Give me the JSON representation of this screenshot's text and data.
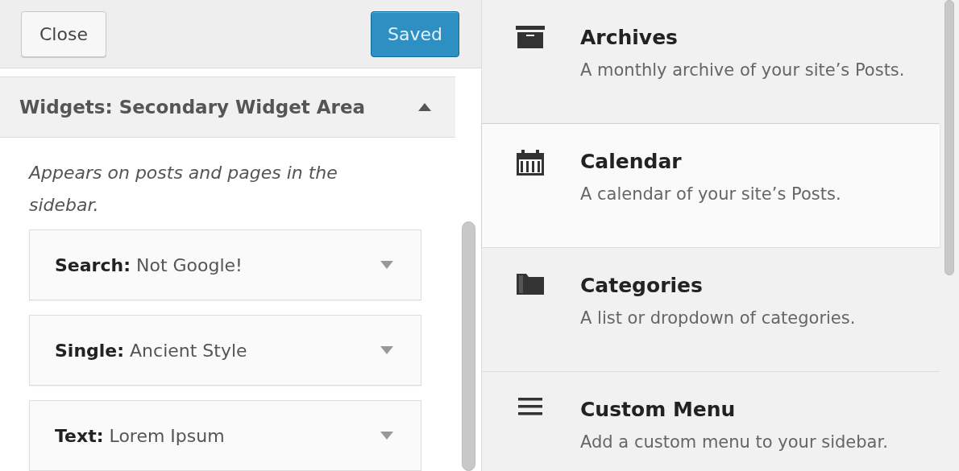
{
  "header": {
    "buttons": [
      {
        "label": "Close",
        "kind": "secondary"
      },
      {
        "label": "Saved",
        "kind": "primary"
      }
    ]
  },
  "section": {
    "title": "Widgets: Secondary Widget Area",
    "expanded": true,
    "description": "Appears on posts and pages in the sidebar.",
    "widgets": [
      {
        "type": "Search:",
        "title": "Not Google!"
      },
      {
        "type": "Single:",
        "title": "Ancient Style"
      },
      {
        "type": "Text:",
        "title": "Lorem Ipsum"
      }
    ]
  },
  "available_widgets": [
    {
      "name": "Archives",
      "description": "A monthly archive of your site’s Posts.",
      "kind": "archive",
      "selected": false
    },
    {
      "name": "Calendar",
      "description": "A calendar of your site’s Posts.",
      "kind": "calendar",
      "selected": true
    },
    {
      "name": "Categories",
      "description": "A list or dropdown of categories.",
      "kind": "folder",
      "selected": false
    },
    {
      "name": "Custom Menu",
      "description": "Add a custom menu to your sidebar.",
      "kind": "menu",
      "selected": false
    }
  ]
}
